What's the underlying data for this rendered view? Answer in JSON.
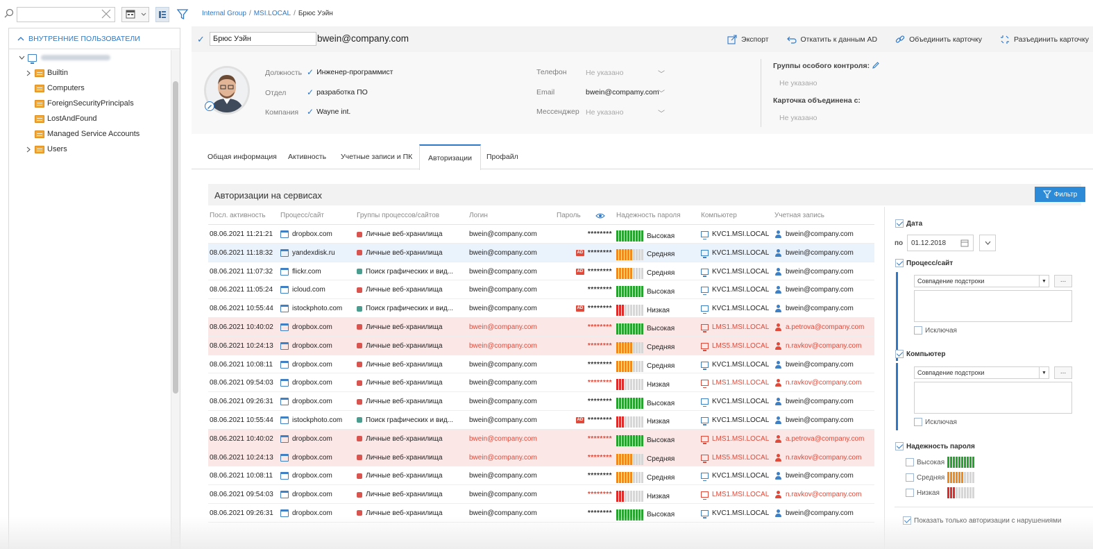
{
  "left_panel": {
    "section_title": "ВНУТРЕННИЕ ПОЛЬЗОВАТЕЛИ",
    "tree": [
      {
        "label": "Builtin",
        "expandable": true
      },
      {
        "label": "Computers",
        "expandable": false
      },
      {
        "label": "ForeignSecurityPrincipals",
        "expandable": false
      },
      {
        "label": "LostAndFound",
        "expandable": false
      },
      {
        "label": "Managed Service Accounts",
        "expandable": false
      },
      {
        "label": "Users",
        "expandable": true
      }
    ]
  },
  "breadcrumb": {
    "items": [
      "Internal Group",
      "MSI.LOCAL",
      "Брюс Уэйн"
    ],
    "sep": "/"
  },
  "card": {
    "name": "Брюс Уэйн",
    "email": "bwein@company.com",
    "actions": {
      "export": "Экспорт",
      "rollback": "Откатить к данным AD",
      "merge": "Объединить карточку",
      "split": "Разъединить карточку"
    }
  },
  "profile": {
    "position_label": "Должность",
    "position_value": "Инженер-программист",
    "department_label": "Отдел",
    "department_value": "разработка ПО",
    "company_label": "Компания",
    "company_value": "Wayne int.",
    "phone_label": "Телефон",
    "phone_value": "Не указано",
    "email_label": "Email",
    "email_value": "bwein@compamy.com",
    "messenger_label": "Мессенджер",
    "messenger_value": "Не указано",
    "control_groups_label": "Группы особого контроля:",
    "control_groups_value": "Не указано",
    "merged_with_label": "Карточка объединена с:",
    "merged_with_value": "Не указано"
  },
  "tabs": {
    "general": "Общая информация",
    "activity": "Активность",
    "accounts": "Учетные записи и ПК",
    "auth": "Авторизации",
    "profile": "Профайл"
  },
  "auth_panel": {
    "title": "Авторизации на сервисах",
    "filter_button": "Фильтр"
  },
  "table": {
    "headers": {
      "time": "Посл. активность",
      "process": "Процесс/сайт",
      "group": "Группы процессов/сайтов",
      "login": "Логин",
      "password": "Пароль",
      "strength": "Надежность пароля",
      "computer": "Компьютер",
      "account": "Учетная запись"
    },
    "rows": [
      {
        "time": "08.06.2021 11:21:21",
        "process": "dropbox.com",
        "group": "Личные веб-хранилища",
        "group_color": "#d9534f",
        "login": "bwein@company.com",
        "ad": false,
        "pass": "********",
        "pass_red": false,
        "strength": "Высокая",
        "level": 3,
        "computer": "KVC1.MSI.LOCAL",
        "account": "bwein@company.com",
        "warn": false,
        "selected": false
      },
      {
        "time": "08.06.2021 11:18:32",
        "process": "yandexdisk.ru",
        "group": "Личные веб-хранилища",
        "group_color": "#d9534f",
        "login": "bwein@company.com",
        "ad": true,
        "pass": "********",
        "pass_red": false,
        "strength": "Средняя",
        "level": 2,
        "computer": "KVC1.MSI.LOCAL",
        "account": "bwein@company.com",
        "warn": false,
        "selected": true
      },
      {
        "time": "08.06.2021 11:07:32",
        "process": "flickr.com",
        "group": "Поиск графических и вид...",
        "group_color": "#4a9d8f",
        "login": "bwein@company.com",
        "ad": true,
        "pass": "********",
        "pass_red": false,
        "strength": "Средняя",
        "level": 2,
        "computer": "KVC1.MSI.LOCAL",
        "account": "bwein@company.com",
        "warn": false,
        "selected": false
      },
      {
        "time": "08.06.2021 11:05:24",
        "process": "icloud.com",
        "group": "Личные веб-хранилища",
        "group_color": "#d9534f",
        "login": "bwein@company.com",
        "ad": false,
        "pass": "********",
        "pass_red": false,
        "strength": "Высокая",
        "level": 3,
        "computer": "KVC1.MSI.LOCAL",
        "account": "bwein@company.com",
        "warn": false,
        "selected": false
      },
      {
        "time": "08.06.2021 10:55:44",
        "process": "istockphoto.com",
        "group": "Поиск графических и вид...",
        "group_color": "#4a9d8f",
        "login": "bwein@company.com",
        "ad": true,
        "pass": "********",
        "pass_red": false,
        "strength": "Низкая",
        "level": 1,
        "computer": "KVC1.MSI.LOCAL",
        "account": "bwein@company.com",
        "warn": false,
        "selected": false
      },
      {
        "time": "08.06.2021 10:40:02",
        "process": "dropbox.com",
        "group": "Личные веб-хранилища",
        "group_color": "#d9534f",
        "login": "bwein@company.com",
        "ad": false,
        "pass": "********",
        "pass_red": true,
        "strength": "Высокая",
        "level": 3,
        "computer": "LMS1.MSI.LOCAL",
        "account": "a.petrova@company.com",
        "warn": true,
        "selected": false
      },
      {
        "time": "08.06.2021 10:24:13",
        "process": "dropbox.com",
        "group": "Личные веб-хранилища",
        "group_color": "#d9534f",
        "login": "bwein@company.com",
        "ad": false,
        "pass": "********",
        "pass_red": true,
        "strength": "Средняя",
        "level": 2,
        "computer": "LMS5.MSI.LOCAL",
        "account": "n.ravkov@company.com",
        "warn": true,
        "selected": false
      },
      {
        "time": "08.06.2021 10:08:11",
        "process": "dropbox.com",
        "group": "Личные веб-хранилища",
        "group_color": "#d9534f",
        "login": "bwein@company.com",
        "ad": false,
        "pass": "********",
        "pass_red": false,
        "strength": "Средняя",
        "level": 2,
        "computer": "KVC1.MSI.LOCAL",
        "account": "bwein@company.com",
        "warn": false,
        "selected": false
      },
      {
        "time": "08.06.2021 09:54:03",
        "process": "dropbox.com",
        "group": "Личные веб-хранилища",
        "group_color": "#d9534f",
        "login": "bwein@company.com",
        "ad": false,
        "pass": "********",
        "pass_red": true,
        "strength": "Низкая",
        "level": 1,
        "computer": "LMS1.MSI.LOCAL",
        "account": "n.ravkov@company.com",
        "warn": false,
        "selected": false,
        "red_pc": true
      },
      {
        "time": "08.06.2021 09:26:31",
        "process": "dropbox.com",
        "group": "Личные веб-хранилища",
        "group_color": "#d9534f",
        "login": "bwein@company.com",
        "ad": false,
        "pass": "********",
        "pass_red": false,
        "strength": "Высокая",
        "level": 3,
        "computer": "KVC1.MSI.LOCAL",
        "account": "bwein@company.com",
        "warn": false,
        "selected": false
      },
      {
        "time": "08.06.2021 10:55:44",
        "process": "istockphoto.com",
        "group": "Поиск графических и вид...",
        "group_color": "#4a9d8f",
        "login": "bwein@company.com",
        "ad": true,
        "pass": "********",
        "pass_red": false,
        "strength": "Низкая",
        "level": 1,
        "computer": "KVC1.MSI.LOCAL",
        "account": "bwein@company.com",
        "warn": false,
        "selected": false
      },
      {
        "time": "08.06.2021 10:40:02",
        "process": "dropbox.com",
        "group": "Личные веб-хранилища",
        "group_color": "#d9534f",
        "login": "bwein@company.com",
        "ad": false,
        "pass": "********",
        "pass_red": true,
        "strength": "Высокая",
        "level": 3,
        "computer": "LMS1.MSI.LOCAL",
        "account": "a.petrova@company.com",
        "warn": true,
        "selected": false
      },
      {
        "time": "08.06.2021 10:24:13",
        "process": "dropbox.com",
        "group": "Личные веб-хранилища",
        "group_color": "#d9534f",
        "login": "bwein@company.com",
        "ad": false,
        "pass": "********",
        "pass_red": true,
        "strength": "Средняя",
        "level": 2,
        "computer": "LMS5.MSI.LOCAL",
        "account": "n.ravkov@company.com",
        "warn": true,
        "selected": false
      },
      {
        "time": "08.06.2021 10:08:11",
        "process": "dropbox.com",
        "group": "Личные веб-хранилища",
        "group_color": "#d9534f",
        "login": "bwein@company.com",
        "ad": false,
        "pass": "********",
        "pass_red": false,
        "strength": "Средняя",
        "level": 2,
        "computer": "KVC1.MSI.LOCAL",
        "account": "bwein@company.com",
        "warn": false,
        "selected": false
      },
      {
        "time": "08.06.2021 09:54:03",
        "process": "dropbox.com",
        "group": "Личные веб-хранилища",
        "group_color": "#d9534f",
        "login": "bwein@company.com",
        "ad": false,
        "pass": "********",
        "pass_red": true,
        "strength": "Низкая",
        "level": 1,
        "computer": "LMS1.MSI.LOCAL",
        "account": "n.ravkov@company.com",
        "warn": false,
        "selected": false,
        "red_pc": true
      },
      {
        "time": "08.06.2021 09:26:31",
        "process": "dropbox.com",
        "group": "Личные веб-хранилища",
        "group_color": "#d9534f",
        "login": "bwein@company.com",
        "ad": false,
        "pass": "********",
        "pass_red": false,
        "strength": "Высокая",
        "level": 3,
        "computer": "KVC1.MSI.LOCAL",
        "account": "bwein@company.com",
        "warn": false,
        "selected": false
      }
    ]
  },
  "filters": {
    "date_label": "Дата",
    "date_to_label": "по",
    "date_value": "01.12.2018",
    "process_label": "Процесс/сайт",
    "process_match": "Совпадение подстроки",
    "process_exclude": "Исключая",
    "computer_label": "Компьютер",
    "computer_match": "Совпадение подстроки",
    "computer_exclude": "Исключая",
    "strength_label": "Надежность пароля",
    "strength_high": "Высокая",
    "strength_mid": "Средняя",
    "strength_low": "Низкая",
    "only_violations": "Показать только авторизации с нарушениями",
    "dots": "..."
  },
  "colors": {
    "accent": "#2d78c8",
    "high": "#27a32f",
    "mid": "#f08a1c",
    "low": "#e02b2b",
    "warn_row": "#fbe7e6"
  }
}
